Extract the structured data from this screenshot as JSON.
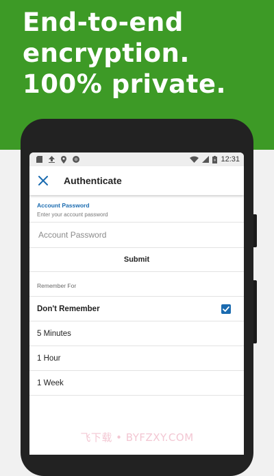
{
  "hero": {
    "line1": "End-to-end",
    "line2": "encryption.",
    "line3": "100% private.",
    "background": "#3d9a26"
  },
  "statusbar": {
    "time": "12:31",
    "icons": [
      "sd-card-icon",
      "upload-icon",
      "location-icon",
      "record-icon",
      "wifi-icon",
      "signal-icon",
      "battery-icon"
    ]
  },
  "toolbar": {
    "title": "Authenticate",
    "close_icon": "close-icon"
  },
  "password_field": {
    "label": "Account Password",
    "help": "Enter your account password",
    "placeholder": "Account Password",
    "value": ""
  },
  "submit": {
    "label": "Submit"
  },
  "remember": {
    "section_label": "Remember For",
    "options": [
      {
        "label": "Don't Remember",
        "selected": true
      },
      {
        "label": "5 Minutes",
        "selected": false
      },
      {
        "label": "1 Hour",
        "selected": false
      },
      {
        "label": "1 Week",
        "selected": false
      }
    ]
  },
  "accent_color": "#1a6bb0",
  "watermark": "飞下载 • BYFZXY.COM"
}
